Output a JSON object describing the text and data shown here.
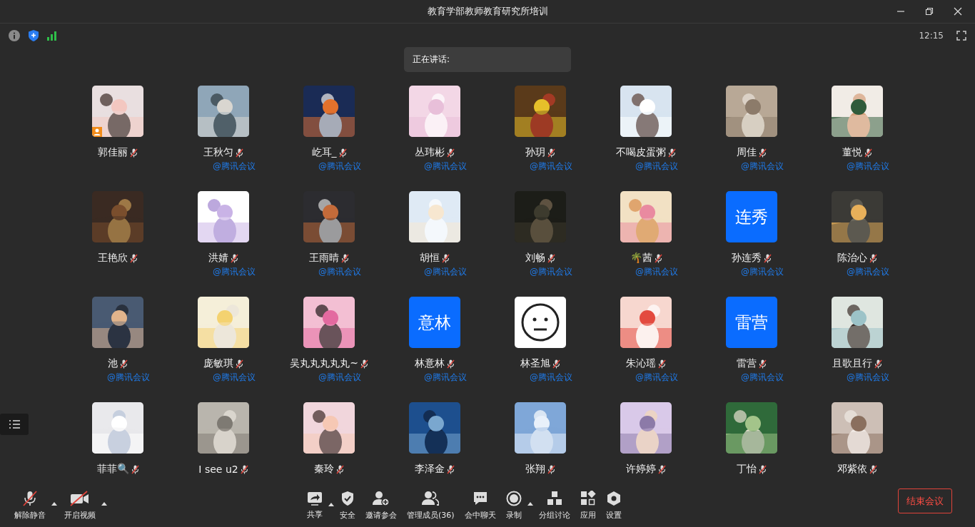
{
  "window": {
    "title": "教育学部教师教育研究所培训"
  },
  "status": {
    "time": "12:15"
  },
  "speaking": {
    "label": "正在讲话:"
  },
  "participants": [
    {
      "name": "郭佳丽",
      "host": true,
      "muted": true
    },
    {
      "name": "王秋匀",
      "tag": "@腾讯会议",
      "host": false,
      "muted": true
    },
    {
      "name": "屹耳_",
      "tag": "@腾讯会议",
      "host": false,
      "muted": true
    },
    {
      "name": "丛玮彬",
      "tag": "@腾讯会议",
      "host": false,
      "muted": true
    },
    {
      "name": "孙玥",
      "tag": "@腾讯会议",
      "host": false,
      "muted": true
    },
    {
      "name": "不喝皮蛋粥",
      "tag": "@腾讯会议",
      "host": false,
      "muted": true
    },
    {
      "name": "周佳",
      "tag": "@腾讯会议",
      "host": false,
      "muted": true
    },
    {
      "name": "董悦",
      "tag": "@腾讯会议",
      "host": false,
      "muted": true
    },
    {
      "name": "王艳欣",
      "host": false,
      "muted": true
    },
    {
      "name": "洪婧",
      "tag": "@腾讯会议",
      "host": false,
      "muted": true
    },
    {
      "name": "王雨晴",
      "tag": "@腾讯会议",
      "host": false,
      "muted": true
    },
    {
      "name": "胡恒",
      "tag": "@腾讯会议",
      "host": false,
      "muted": true
    },
    {
      "name": "刘畅",
      "tag": "@腾讯会议",
      "host": false,
      "muted": true
    },
    {
      "name": "🌴茜",
      "tag": "@腾讯会议",
      "host": false,
      "muted": true
    },
    {
      "name": "孙连秀",
      "tag": "@腾讯会议",
      "host": false,
      "muted": true,
      "avatar": {
        "kind": "text",
        "text": "连秀"
      }
    },
    {
      "name": "陈治心",
      "tag": "@腾讯会议",
      "host": false,
      "muted": true
    },
    {
      "name": "池",
      "tag": "@腾讯会议",
      "host": false,
      "muted": true
    },
    {
      "name": "庞敏琪",
      "tag": "@腾讯会议",
      "host": false,
      "muted": true
    },
    {
      "name": "吴丸丸丸丸丸~",
      "tag": "@腾讯会议",
      "host": false,
      "muted": true
    },
    {
      "name": "林意林",
      "tag": "@腾讯会议",
      "host": false,
      "muted": true,
      "avatar": {
        "kind": "text",
        "text": "意林"
      }
    },
    {
      "name": "林圣旭",
      "tag": "@腾讯会议",
      "host": false,
      "muted": true,
      "avatar": {
        "kind": "face"
      }
    },
    {
      "name": "朱沁瑶",
      "tag": "@腾讯会议",
      "host": false,
      "muted": true
    },
    {
      "name": "雷营",
      "tag": "@腾讯会议",
      "host": false,
      "muted": true,
      "avatar": {
        "kind": "text",
        "text": "雷营"
      }
    },
    {
      "name": "且歌且行",
      "tag": "@腾讯会议",
      "host": false,
      "muted": true
    },
    {
      "name": "菲菲🔍",
      "host": false,
      "muted": true
    },
    {
      "name": "I see u2",
      "host": false,
      "muted": true
    },
    {
      "name": "秦玲",
      "host": false,
      "muted": true
    },
    {
      "name": "李泽金",
      "host": false,
      "muted": true
    },
    {
      "name": "张翔",
      "host": false,
      "muted": true
    },
    {
      "name": "许婷婷",
      "host": false,
      "muted": true
    },
    {
      "name": "丁怡",
      "host": false,
      "muted": true
    },
    {
      "name": "邓紫依",
      "host": false,
      "muted": true
    }
  ],
  "toolbar_left": [
    {
      "label": "解除静音",
      "caret": true
    },
    {
      "label": "开启视频",
      "caret": true
    }
  ],
  "toolbar_center": [
    {
      "label": "共享",
      "caret": true
    },
    {
      "label": "安全",
      "caret": false
    },
    {
      "label": "邀请参会",
      "caret": false
    },
    {
      "label": "管理成员(36)",
      "caret": false
    },
    {
      "label": "会中聊天",
      "caret": false
    },
    {
      "label": "录制",
      "caret": true
    },
    {
      "label": "分组讨论",
      "caret": false
    },
    {
      "label": "应用",
      "caret": false
    },
    {
      "label": "设置",
      "caret": false
    }
  ],
  "end_button": {
    "label": "结束会议"
  }
}
